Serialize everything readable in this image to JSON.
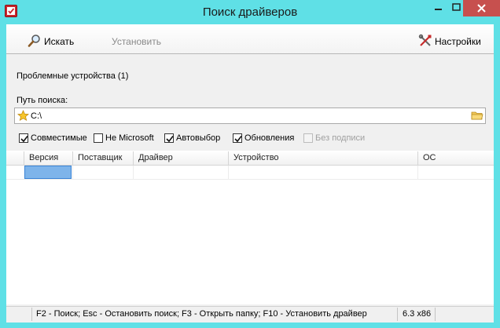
{
  "window": {
    "title": "Поиск драйверов"
  },
  "toolbar": {
    "search_label": "Искать",
    "install_label": "Установить",
    "settings_label": "Настройки"
  },
  "main": {
    "problem_devices": "Проблемные устройства (1)",
    "search_path_label": "Путь поиска:",
    "search_path_value": "C:\\"
  },
  "options": [
    {
      "label": "Совместимые",
      "checked": true,
      "enabled": true
    },
    {
      "label": "Не Microsoft",
      "checked": false,
      "enabled": true
    },
    {
      "label": "Автовыбор",
      "checked": true,
      "enabled": true
    },
    {
      "label": "Обновления",
      "checked": true,
      "enabled": true
    },
    {
      "label": "Без подписи",
      "checked": false,
      "enabled": false
    }
  ],
  "table": {
    "columns": [
      "Версия",
      "Поставщик",
      "Драйвер",
      "Устройство",
      "ОС"
    ]
  },
  "statusbar": {
    "hints": "F2 - Поиск;   Esc - Остановить поиск;   F3 - Открыть папку;   F10 - Установить драйвер",
    "version": "6.3 x86"
  },
  "colors": {
    "frame": "#5fe0e6",
    "close_button": "#c7504e",
    "selection": "#7eb4ea"
  }
}
